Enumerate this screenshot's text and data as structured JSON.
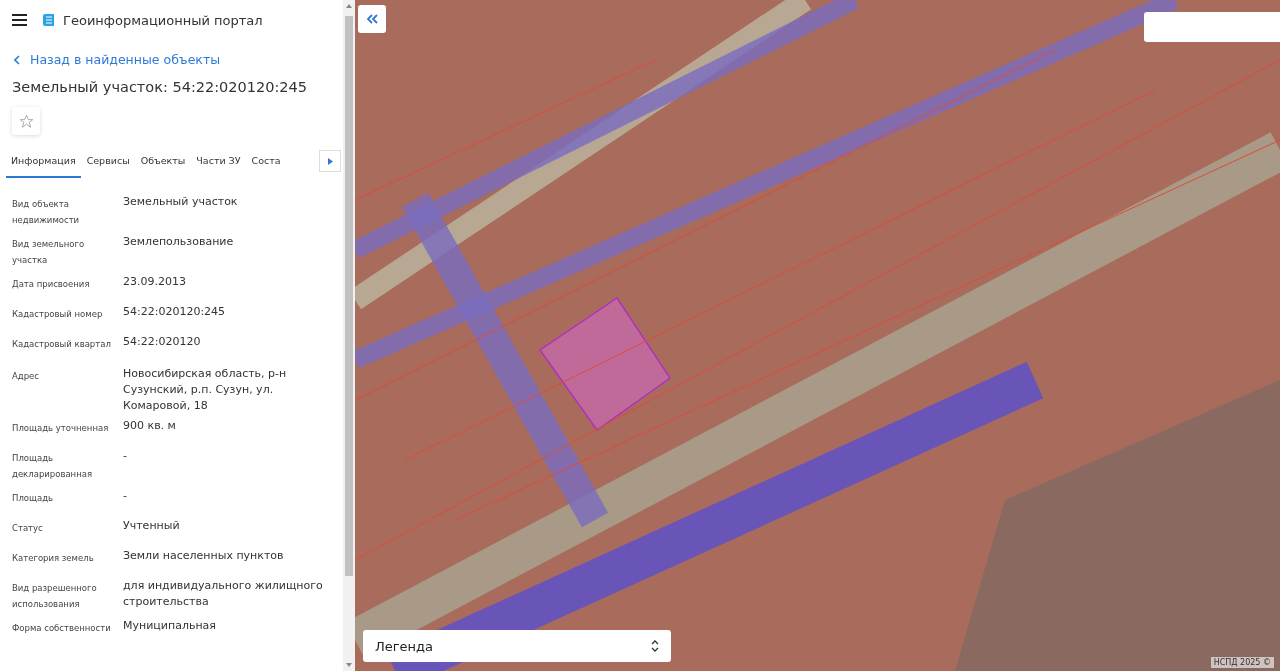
{
  "header": {
    "title": "Геоинформационный портал"
  },
  "back_link": "Назад в найденные объекты",
  "object_title": "Земельный участок: 54:22:020120:245",
  "favorite": {
    "selected": false
  },
  "tabs": [
    {
      "label": "Информация",
      "selected": true
    },
    {
      "label": "Сервисы",
      "selected": false
    },
    {
      "label": "Объекты",
      "selected": false
    },
    {
      "label": "Части ЗУ",
      "selected": false
    },
    {
      "label": "Соста",
      "selected": false
    }
  ],
  "fields": [
    {
      "label": "Вид объекта недвижимости",
      "value": "Земельный участок"
    },
    {
      "label": "Вид земельного участка",
      "value": "Землепользование"
    },
    {
      "label": "Дата присвоения",
      "value": "23.09.2013"
    },
    {
      "label": "Кадастровый номер",
      "value": "54:22:020120:245"
    },
    {
      "label": "Кадастровый квартал",
      "value": "54:22:020120"
    },
    {
      "label": "Адрес",
      "value": "Новосибирская область, р-н Сузунский, р.п. Сузун, ул. Комаровой, 18"
    },
    {
      "label": "Площадь уточненная",
      "value": "900 кв. м"
    },
    {
      "label": "Площадь декларированная",
      "value": "-"
    },
    {
      "label": "Площадь",
      "value": "-"
    },
    {
      "label": "Статус",
      "value": "Учтенный"
    },
    {
      "label": "Категория земель",
      "value": "Земли населенных пунктов"
    },
    {
      "label": "Вид разрешенного использования",
      "value": "для индивидуального жилищного строительства"
    },
    {
      "label": "Форма собственности",
      "value": "Муниципальная"
    }
  ],
  "map": {
    "legend": "Легенда",
    "attribution": "НСПД 2025 ©"
  }
}
